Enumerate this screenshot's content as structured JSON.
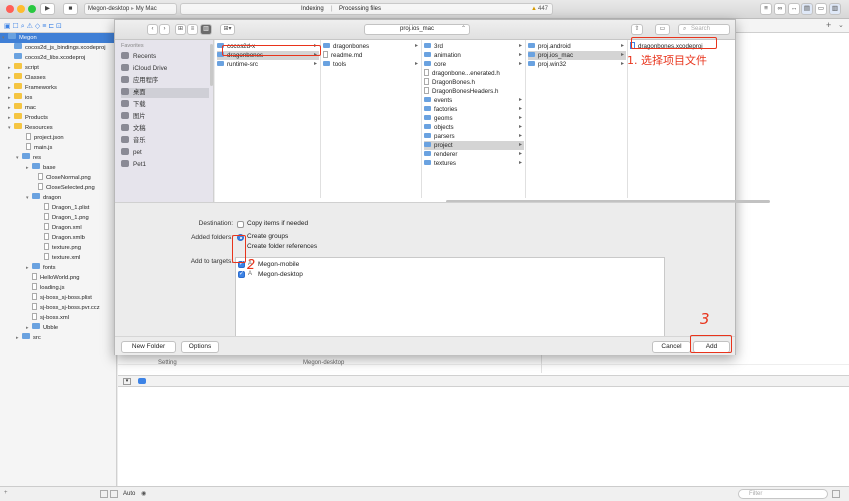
{
  "toolbar": {
    "scheme": "Megon-desktop",
    "destination": "My Mac",
    "activity_left": "Indexing",
    "activity_right": "Processing files",
    "warning_count": "447"
  },
  "navigator": {
    "items": [
      {
        "label": "Megon",
        "kind": "project",
        "sel": true
      },
      {
        "label": "cocos2d_js_bindings.xcodeproj",
        "kind": "proj"
      },
      {
        "label": "cocos2d_libs.xcodeproj",
        "kind": "proj"
      },
      {
        "label": "script",
        "kind": "folder"
      },
      {
        "label": "Classes",
        "kind": "folder"
      },
      {
        "label": "Frameworks",
        "kind": "folder"
      },
      {
        "label": "ios",
        "kind": "folder"
      },
      {
        "label": "mac",
        "kind": "folder"
      },
      {
        "label": "Products",
        "kind": "folder"
      },
      {
        "label": "Resources",
        "kind": "folder"
      },
      {
        "label": "project.json",
        "kind": "file"
      },
      {
        "label": "main.js",
        "kind": "file"
      },
      {
        "label": "res",
        "kind": "bfolder"
      },
      {
        "label": "base",
        "kind": "bfolder"
      },
      {
        "label": "CloseNormal.png",
        "kind": "file"
      },
      {
        "label": "CloseSelected.png",
        "kind": "file"
      },
      {
        "label": "dragon",
        "kind": "bfolder"
      },
      {
        "label": "Dragon_1.plist",
        "kind": "file"
      },
      {
        "label": "Dragon_1.png",
        "kind": "file"
      },
      {
        "label": "Dragon.xml",
        "kind": "file"
      },
      {
        "label": "Dragon.xmlb",
        "kind": "file"
      },
      {
        "label": "texture.png",
        "kind": "file"
      },
      {
        "label": "texture.xml",
        "kind": "file"
      },
      {
        "label": "fonts",
        "kind": "bfolder"
      },
      {
        "label": "HelloWorld.png",
        "kind": "file"
      },
      {
        "label": "loading.js",
        "kind": "file"
      },
      {
        "label": "sj-boss_sj-boss.plist",
        "kind": "file"
      },
      {
        "label": "sj-boss_sj-boss.pvr.ccz",
        "kind": "file"
      },
      {
        "label": "sj-boss.xml",
        "kind": "file"
      },
      {
        "label": "Ubble",
        "kind": "bfolder"
      },
      {
        "label": "src",
        "kind": "bfolder"
      }
    ]
  },
  "sheet": {
    "path": "proj.ios_mac",
    "search_placeholder": "Search",
    "sidebar_heading": "Favorites",
    "sidebar": [
      "Recents",
      "iCloud Drive",
      "应用程序",
      "桌面",
      "下载",
      "图片",
      "文稿",
      "音乐",
      "pet",
      "Pet1"
    ],
    "col1": [
      "cocos2d-x",
      "dragonbones",
      "runtime-src"
    ],
    "col2": [
      "dragonbones",
      "readme.md",
      "tools"
    ],
    "col3": [
      "3rd",
      "animation",
      "core",
      "dragonbone...enerated.h",
      "DragonBones.h",
      "DragonBonesHeaders.h",
      "events",
      "factories",
      "geoms",
      "objects",
      "parsers",
      "project",
      "renderer",
      "textures"
    ],
    "col4": [
      "proj.android",
      "proj.ios_mac",
      "proj.win32"
    ],
    "col5": [
      "dragonbones.xcodeproj"
    ],
    "destination_label": "Destination:",
    "copy_items": "Copy items if needed",
    "added_folders_label": "Added folders:",
    "create_groups": "Create groups",
    "create_refs": "Create folder references",
    "targets_label": "Add to targets:",
    "targets": [
      "Megon-mobile",
      "Megon-desktop"
    ],
    "new_folder": "New Folder",
    "options": "Options",
    "cancel": "Cancel",
    "add": "Add"
  },
  "editor": {
    "setting_label": "Setting",
    "setting_value": "Megon-desktop"
  },
  "status": {
    "auto": "Auto",
    "filter_placeholder": "Filter"
  },
  "annotations": {
    "step1": "1. 选择项目文件",
    "step2": "2",
    "step3": "3"
  },
  "colors": {
    "accent": "#3d83e6",
    "annotation": "#e8341c"
  }
}
